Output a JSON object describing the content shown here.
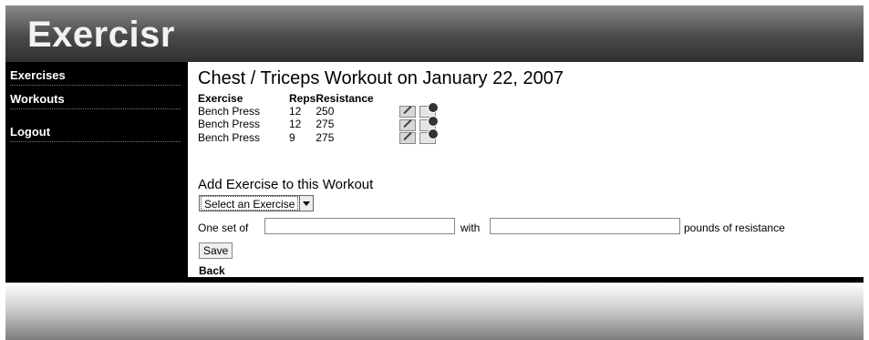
{
  "app": {
    "logo": "Exercisr"
  },
  "sidebar": {
    "items": [
      {
        "label": "Exercises"
      },
      {
        "label": "Workouts"
      },
      {
        "label": "Logout"
      }
    ]
  },
  "main": {
    "title": "Chest / Triceps Workout on January 22, 2007",
    "table": {
      "headers": {
        "exercise": "Exercise",
        "reps": "Reps",
        "resistance": "Resistance"
      },
      "rows": [
        {
          "exercise": "Bench Press",
          "reps": "12",
          "resistance": "250",
          "actions": [
            "edit-icon",
            "delete-icon"
          ]
        },
        {
          "exercise": "Bench Press",
          "reps": "12",
          "resistance": "275",
          "actions": [
            "edit-icon",
            "delete-icon"
          ]
        },
        {
          "exercise": "Bench Press",
          "reps": "9",
          "resistance": "275",
          "actions": [
            "edit-icon",
            "delete-icon"
          ]
        }
      ]
    },
    "add_form": {
      "heading": "Add Exercise to this Workout",
      "select_value": "Select an Exercise",
      "label_prefix": "One set of",
      "reps_value": "",
      "label_with": "with",
      "resistance_value": "",
      "label_suffix": "pounds of resistance",
      "save_label": "Save"
    },
    "back_label": "Back"
  },
  "colors": {
    "background": "#000000",
    "content": "#ffffff",
    "logo_text": "#f2f2f2"
  }
}
